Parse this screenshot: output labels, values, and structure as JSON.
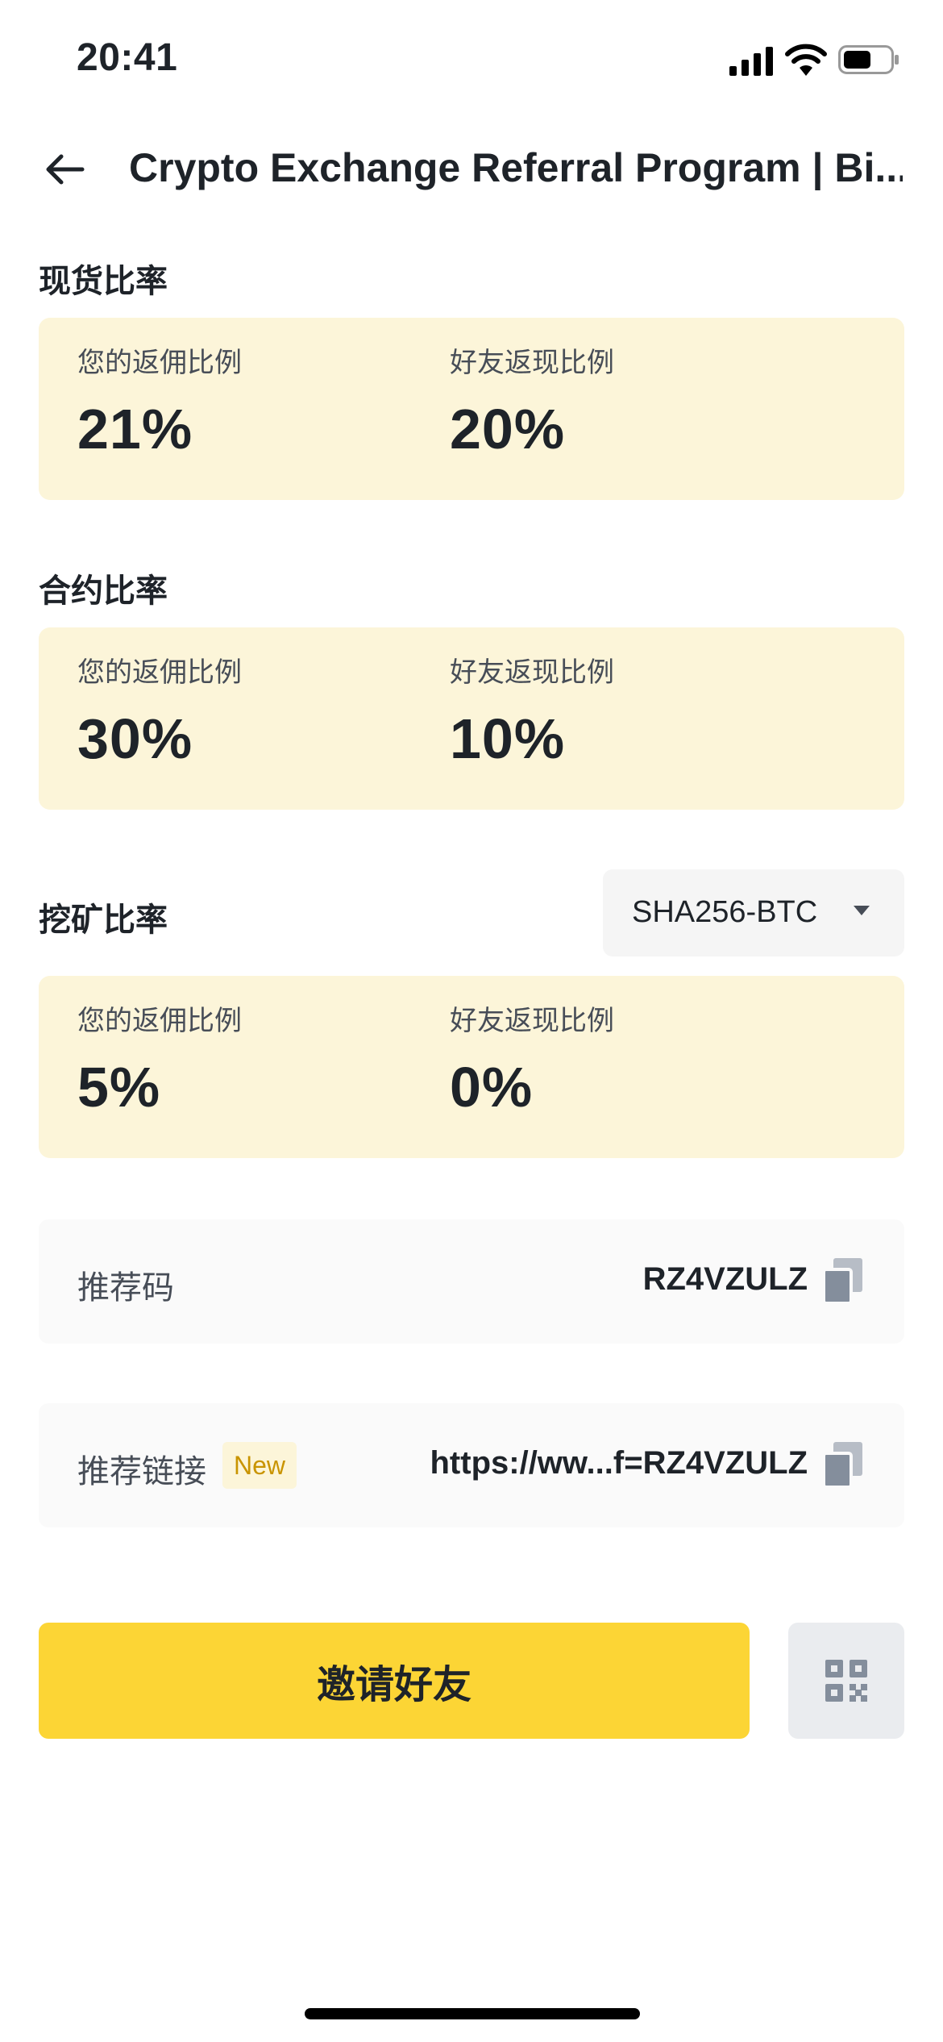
{
  "status_bar": {
    "time": "20:41"
  },
  "nav": {
    "title": "Crypto Exchange Referral Program | Bi..."
  },
  "spot": {
    "title": "现货比率",
    "your_label": "您的返佣比例",
    "your_value": "21%",
    "friend_label": "好友返现比例",
    "friend_value": "20%"
  },
  "futures": {
    "title": "合约比率",
    "your_label": "您的返佣比例",
    "your_value": "30%",
    "friend_label": "好友返现比例",
    "friend_value": "10%"
  },
  "mining": {
    "title": "挖矿比率",
    "algorithm": "SHA256-BTC",
    "your_label": "您的返佣比例",
    "your_value": "5%",
    "friend_label": "好友返现比例",
    "friend_value": "0%"
  },
  "referral_code": {
    "label": "推荐码",
    "value": "RZ4VZULZ"
  },
  "referral_link": {
    "label": "推荐链接",
    "badge": "New",
    "value": "https://ww...f=RZ4VZULZ"
  },
  "actions": {
    "invite_label": "邀请好友"
  },
  "colors": {
    "accent": "#fcd535",
    "card_bg": "#fcf5d9",
    "badge_text": "#c99400"
  }
}
